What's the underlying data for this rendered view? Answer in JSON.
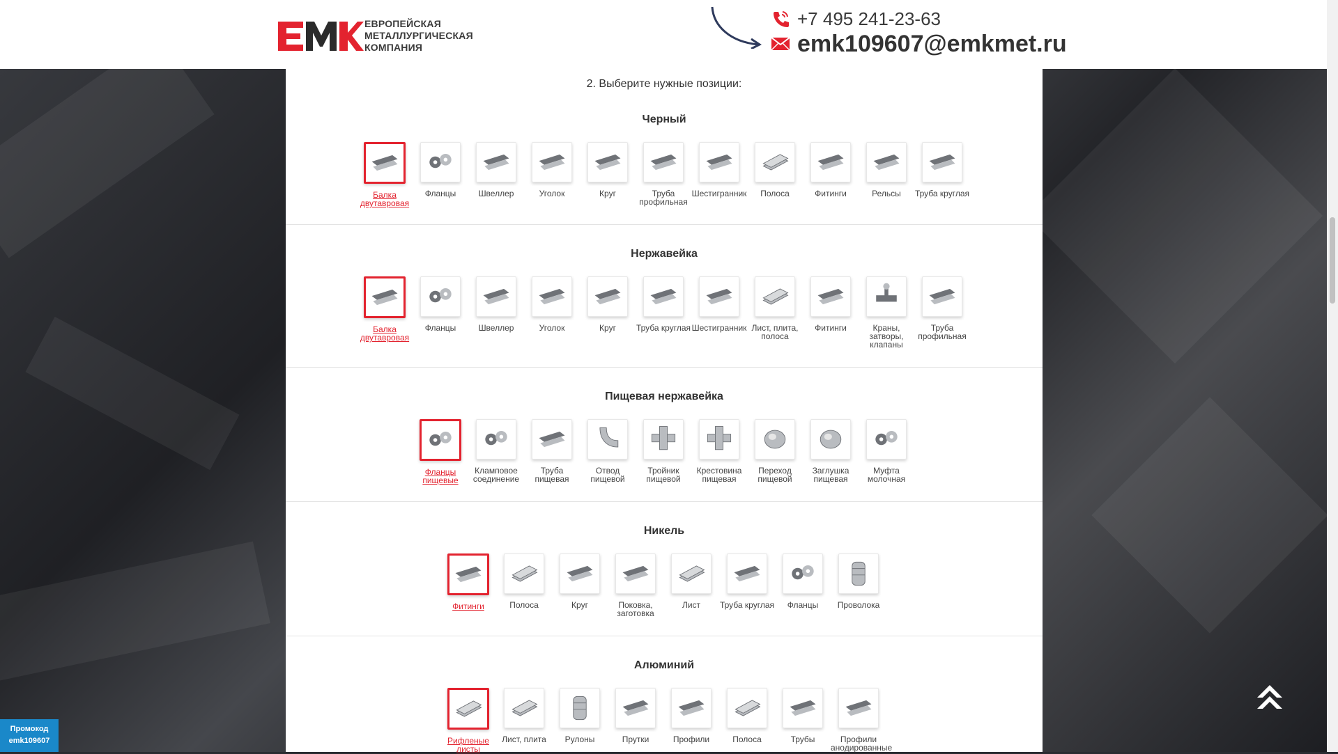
{
  "header": {
    "logo_lines": [
      "ЕВРОПЕЙСКАЯ",
      "МЕТАЛЛУРГИЧЕСКАЯ",
      "КОМПАНИЯ"
    ],
    "phone": "+7 495 241-23-63",
    "email": "emk109607@emkmet.ru"
  },
  "step_text": "2. Выберите нужные позиции:",
  "sections": [
    {
      "title": "Черный",
      "items": [
        {
          "label": "Балка двутавровая",
          "active": true,
          "icon": "beam-icon"
        },
        {
          "label": "Фланцы",
          "icon": "flange-icon"
        },
        {
          "label": "Швеллер",
          "icon": "channel-icon"
        },
        {
          "label": "Уголок",
          "icon": "angle-icon"
        },
        {
          "label": "Круг",
          "icon": "rod-icon"
        },
        {
          "label": "Труба профильная",
          "icon": "profile-pipe-icon"
        },
        {
          "label": "Шестигранник",
          "icon": "hexagon-bar-icon"
        },
        {
          "label": "Полоса",
          "icon": "strip-icon"
        },
        {
          "label": "Фитинги",
          "icon": "fittings-icon"
        },
        {
          "label": "Рельсы",
          "icon": "rail-icon"
        },
        {
          "label": "Труба круглая",
          "icon": "round-pipe-icon"
        }
      ]
    },
    {
      "title": "Нержавейка",
      "items": [
        {
          "label": "Балка двутавровая",
          "active": true,
          "icon": "beam-icon"
        },
        {
          "label": "Фланцы",
          "icon": "flange-icon"
        },
        {
          "label": "Швеллер",
          "icon": "channel-icon"
        },
        {
          "label": "Уголок",
          "icon": "angle-icon"
        },
        {
          "label": "Круг",
          "icon": "rod-icon"
        },
        {
          "label": "Труба круглая",
          "icon": "round-pipe-icon"
        },
        {
          "label": "Шестигранник",
          "icon": "hexagon-bar-icon"
        },
        {
          "label": "Лист, плита, полоса",
          "icon": "sheet-icon"
        },
        {
          "label": "Фитинги",
          "icon": "fittings-icon"
        },
        {
          "label": "Краны, затворы, клапаны",
          "icon": "valve-icon"
        },
        {
          "label": "Труба профильная",
          "icon": "profile-pipe-icon"
        }
      ]
    },
    {
      "title": "Пищевая нержавейка",
      "items": [
        {
          "label": "Фланцы пищевые",
          "active": true,
          "icon": "flange-icon"
        },
        {
          "label": "Кламповое соединение",
          "icon": "clamp-icon"
        },
        {
          "label": "Труба пищевая",
          "icon": "round-pipe-icon"
        },
        {
          "label": "Отвод пищевой",
          "icon": "elbow-icon"
        },
        {
          "label": "Тройник пищевой",
          "icon": "tee-icon"
        },
        {
          "label": "Крестовина пищевая",
          "icon": "cross-icon"
        },
        {
          "label": "Переход пищевой",
          "icon": "reducer-icon"
        },
        {
          "label": "Заглушка пищевая",
          "icon": "cap-icon"
        },
        {
          "label": "Муфта молочная",
          "icon": "coupling-icon"
        }
      ]
    },
    {
      "title": "Никель",
      "items": [
        {
          "label": "Фитинги",
          "active": true,
          "icon": "fittings-icon"
        },
        {
          "label": "Полоса",
          "icon": "strip-icon"
        },
        {
          "label": "Круг",
          "icon": "rod-icon"
        },
        {
          "label": "Поковка, заготовка",
          "icon": "forging-icon"
        },
        {
          "label": "Лист",
          "icon": "sheet-icon"
        },
        {
          "label": "Труба круглая",
          "icon": "round-pipe-icon"
        },
        {
          "label": "Фланцы",
          "icon": "flange-icon"
        },
        {
          "label": "Проволока",
          "icon": "wire-icon"
        }
      ]
    },
    {
      "title": "Алюминий",
      "items": [
        {
          "label": "Рифленые листы",
          "active": true,
          "icon": "ribbed-sheet-icon"
        },
        {
          "label": "Лист, плита",
          "icon": "sheet-icon"
        },
        {
          "label": "Рулоны",
          "icon": "coil-icon"
        },
        {
          "label": "Прутки",
          "icon": "rod-icon"
        },
        {
          "label": "Профили",
          "icon": "profile-icon"
        },
        {
          "label": "Полоса",
          "icon": "strip-icon"
        },
        {
          "label": "Трубы",
          "icon": "round-pipe-icon"
        },
        {
          "label": "Профили анодированные",
          "icon": "anodized-profile-icon"
        }
      ]
    }
  ],
  "promo": {
    "line1": "Промокод",
    "line2": "emk109607"
  },
  "colors": {
    "accent": "#e3232f",
    "promo": "#1a88c9",
    "arrow": "#2e3a5c"
  }
}
